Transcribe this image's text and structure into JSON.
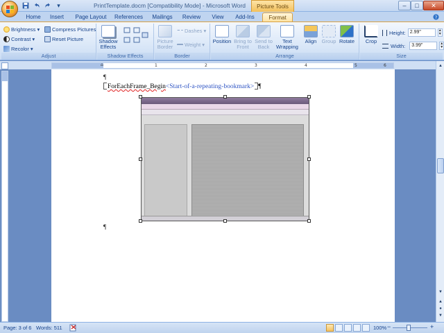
{
  "window": {
    "title": "PrintTemplate.docm [Compatibility Mode] - Microsoft Word",
    "contextual_tab_title": "Picture Tools"
  },
  "qat": {
    "save": "save-icon",
    "undo": "undo-icon",
    "redo": "redo-icon",
    "customize": "▾"
  },
  "tabs": [
    "Home",
    "Insert",
    "Page Layout",
    "References",
    "Mailings",
    "Review",
    "View",
    "Add-Ins",
    "Format"
  ],
  "active_tab": "Format",
  "ribbon": {
    "adjust": {
      "label": "Adjust",
      "brightness": "Brightness",
      "contrast": "Contrast",
      "recolor": "Recolor",
      "compress": "Compress Pictures",
      "reset": "Reset Picture"
    },
    "shadow": {
      "label": "Shadow Effects",
      "button": "Shadow Effects"
    },
    "border": {
      "label": "Border",
      "picture_border": "Picture Border",
      "dashes": "Dashes",
      "weight": "Weight"
    },
    "arrange": {
      "label": "Arrange",
      "position": "Position",
      "bring_to_front": "Bring to Front",
      "send_to_back": "Send to Back",
      "text_wrapping": "Text Wrapping",
      "align": "Align",
      "group": "Group",
      "rotate": "Rotate"
    },
    "size": {
      "label": "Size",
      "crop": "Crop",
      "height_label": "Height:",
      "height_value": "2.99\"",
      "width_label": "Width:",
      "width_value": "3.99\""
    }
  },
  "ruler": {
    "numbers": [
      "1",
      "2",
      "3",
      "4",
      "5",
      "6"
    ]
  },
  "document": {
    "pilcrow": "¶",
    "field_name": "ForEachFrame_Begin",
    "field_comment": "<Start-of-a-repeating-bookmark>",
    "end_pilcrow": "¶"
  },
  "status": {
    "page": "Page: 3 of 6",
    "words": "Words: 511",
    "zoom": "100%"
  },
  "colors": {
    "ribbon_bg": "#dbe8f8",
    "contextual_tab": "#f3c15c",
    "doc_background": "#6a8cc2",
    "bookmark_text": "#2f55c4"
  }
}
